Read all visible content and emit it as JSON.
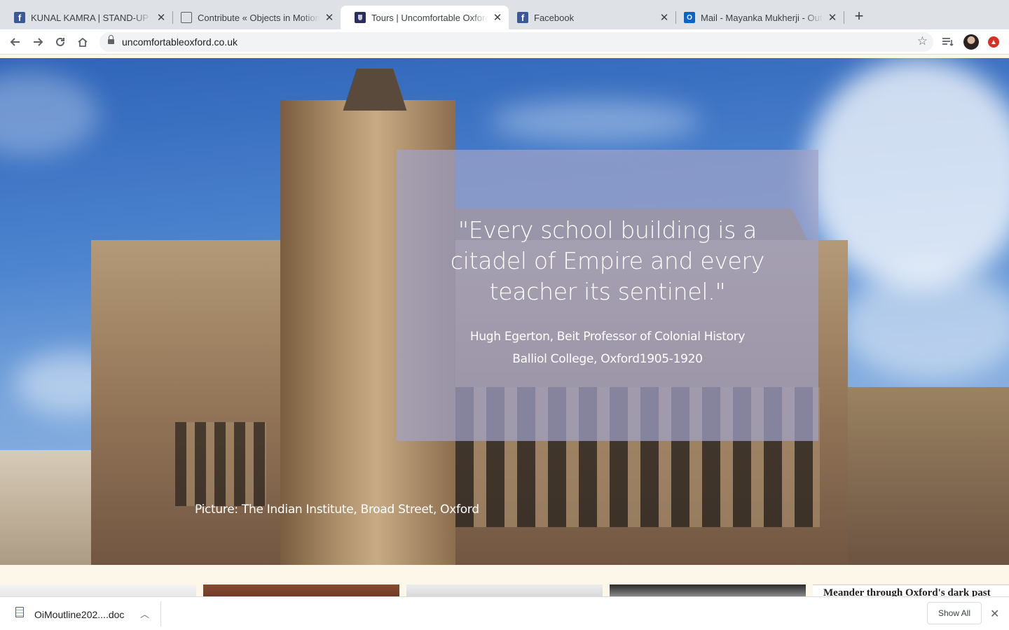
{
  "browser": {
    "tabs": [
      {
        "title": "KUNAL KAMRA | STAND-UP on",
        "icon": "facebook-icon"
      },
      {
        "title": "Contribute « Objects in Motion",
        "icon": "globe-icon"
      },
      {
        "title": "Tours | Uncomfortable Oxford",
        "icon": "uncomfortable-oxford-icon",
        "active": true
      },
      {
        "title": "Facebook",
        "icon": "facebook-icon"
      },
      {
        "title": "Mail - Mayanka Mukherji - Outlook",
        "icon": "outlook-icon"
      }
    ],
    "close_glyph": "✕",
    "new_tab_glyph": "+",
    "facebook_glyph": "f",
    "outlook_glyph": "O",
    "url": "uncomfortableoxford.co.uk"
  },
  "hero": {
    "quote": "\"Every school building is a citadel of Empire and every teacher its sentinel.\"",
    "attribution_line1": "Hugh Egerton, Beit Professor of Colonial History",
    "attribution_line2": "Balliol College, Oxford1905-1920",
    "caption": "Picture: The Indian Institute, Broad Street, Oxford"
  },
  "promo": {
    "text": "Meander through Oxford's dark past"
  },
  "downloads": {
    "file_name": "OiMoutline202....doc",
    "show_all": "Show All"
  },
  "colors": {
    "overlay": "#a0a2c8",
    "page_background": "#fdf7ea",
    "tabstrip": "#dee1e6"
  }
}
